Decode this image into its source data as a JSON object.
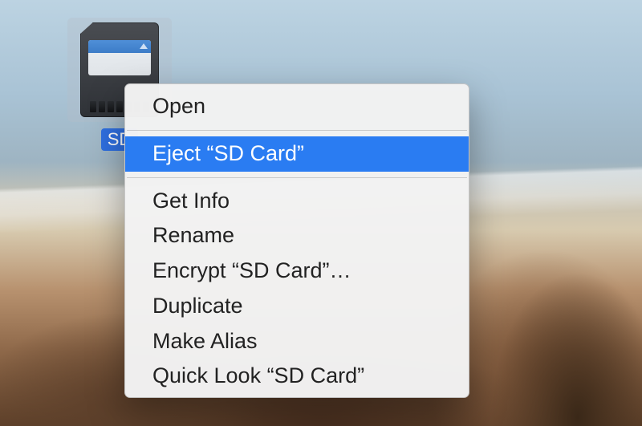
{
  "desktop": {
    "icon_label": "SD"
  },
  "menu": {
    "items": {
      "open": "Open",
      "eject": "Eject “SD Card”",
      "get_info": "Get Info",
      "rename": "Rename",
      "encrypt": "Encrypt “SD Card”…",
      "duplicate": "Duplicate",
      "make_alias": "Make Alias",
      "quick_look": "Quick Look “SD Card”"
    },
    "highlighted": "eject"
  },
  "colors": {
    "selection_bg": "#2a7cf2",
    "selection_text": "#ffffff",
    "icon_label_bg": "#2f6fe0"
  }
}
